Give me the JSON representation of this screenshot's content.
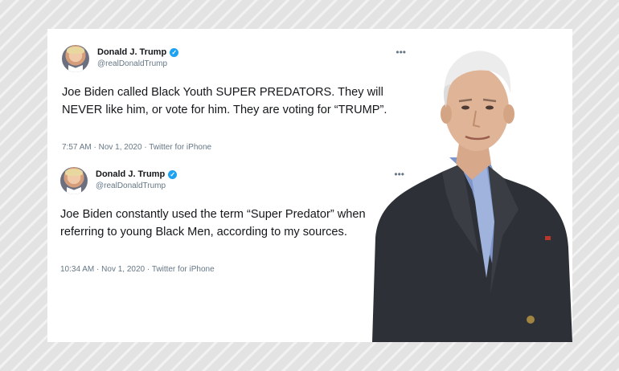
{
  "tweets": [
    {
      "name": "Donald J. Trump",
      "handle": "@realDonaldTrump",
      "text": "Joe Biden called Black Youth SUPER PREDATORS. They will NEVER like him, or vote for him. They are voting for “TRUMP”.",
      "time": "7:57 AM",
      "date": "Nov 1, 2020",
      "source": "Twitter for iPhone"
    },
    {
      "name": "Donald J. Trump",
      "handle": "@realDonaldTrump",
      "text": "Joe Biden constantly used the term “Super Predator” when referring to young Black Men, according to my sources.",
      "time": "10:34 AM",
      "date": "Nov 1, 2020",
      "source": "Twitter for iPhone"
    }
  ],
  "icons": {
    "verified": "verified-badge-icon",
    "more": "more-options-icon"
  },
  "colors": {
    "verified": "#1da1f2",
    "text": "#14171a",
    "muted": "#657786"
  }
}
